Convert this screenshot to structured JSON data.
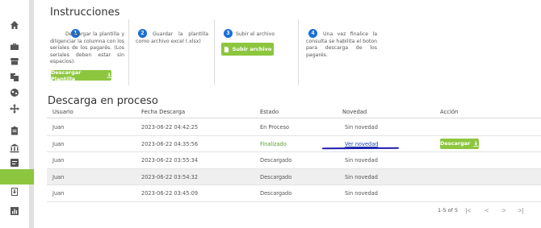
{
  "sidebar": {
    "icons": [
      "home-icon",
      "briefcase-icon",
      "store-icon",
      "copy-icon",
      "globe-icon",
      "move-icon",
      "clipboard-icon",
      "bank-icon",
      "checklist-icon",
      "active-item",
      "download-box-icon",
      "chart-icon"
    ]
  },
  "instructions": {
    "title": "Instrucciones",
    "steps": [
      {
        "number": "1",
        "text": "Descargar la plantilla y diligenciar la columna con los seriales de los pagarés. (Los seriales deben estar sin espacios).",
        "button": "Descargar Plantilla"
      },
      {
        "number": "2",
        "text": "Guardar la plantilla como archivo excel (.xlsx)"
      },
      {
        "number": "3",
        "text": "Subir el archivo",
        "button": "Subir archivo"
      },
      {
        "number": "4",
        "text": "Una vez finalice la consulta se habilita el boton para descarga de los pagarés."
      }
    ]
  },
  "process": {
    "title": "Descarga en proceso",
    "columns": [
      "Usuario",
      "Fecha Descarga",
      "Estado",
      "Novedad",
      "Acción"
    ],
    "rows": [
      {
        "usuario": "Juan",
        "fecha": "2023-06-22 04:42:25",
        "estado": "En Proceso",
        "novedad": "Sin novedad",
        "accion": ""
      },
      {
        "usuario": "Juan",
        "fecha": "2023-06-22 04:35:56",
        "estado": "Finalizado",
        "novedad": "Ver novedad",
        "accion": "Descargar"
      },
      {
        "usuario": "Juan",
        "fecha": "2023-06-22 03:55:34",
        "estado": "Descargado",
        "novedad": "Sin novedad",
        "accion": ""
      },
      {
        "usuario": "Juan",
        "fecha": "2023-06-22 03:54:32",
        "estado": "Descargado",
        "novedad": "Sin novedad",
        "accion": ""
      },
      {
        "usuario": "Juan",
        "fecha": "2023-06-22 03:45:09",
        "estado": "Descargado",
        "novedad": "Sin novedad",
        "accion": ""
      }
    ]
  },
  "pagination": {
    "label": "1-5 of 5",
    "first": "|<",
    "prev": "<",
    "next": ">",
    "last": ">|"
  },
  "colors": {
    "accent_green": "#8cc63f",
    "badge_blue": "#1a6fd8",
    "annotation_line": "#1c1cb0"
  }
}
